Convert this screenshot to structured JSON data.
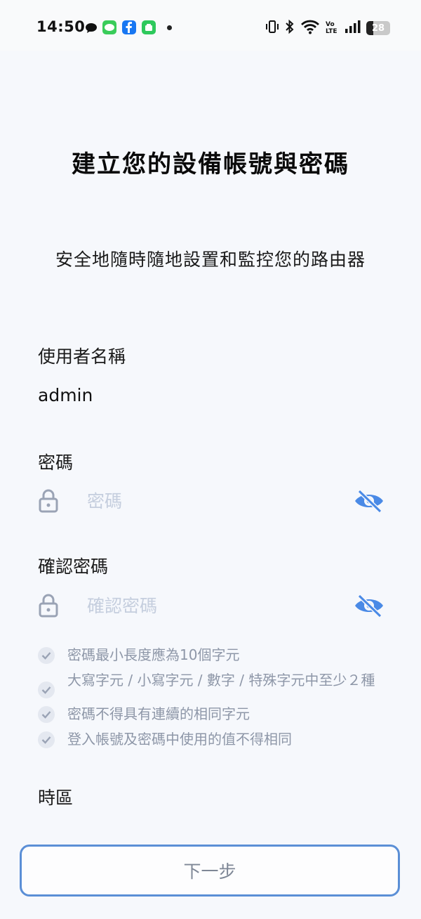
{
  "status_bar": {
    "time": "14:50",
    "network": "Vo LTE",
    "battery": "28"
  },
  "page": {
    "title": "建立您的設備帳號與密碼",
    "subtitle": "安全地隨時隨地設置和監控您的路由器"
  },
  "username": {
    "label": "使用者名稱",
    "value": "admin"
  },
  "password": {
    "label": "密碼",
    "placeholder": "密碼"
  },
  "confirm_password": {
    "label": "確認密碼",
    "placeholder": "確認密碼"
  },
  "rules": [
    "密碼最小長度應為10個字元",
    "大寫字元 / 小寫字元 / 數字 / 特殊字元中至少２種",
    "密碼不得具有連續的相同字元",
    "登入帳號及密碼中使用的值不得相同"
  ],
  "timezone": {
    "label": "時區"
  },
  "next_button": {
    "label": "下一步"
  },
  "colors": {
    "accent": "#4a8ae6",
    "muted_icon": "#9aa3b5"
  }
}
